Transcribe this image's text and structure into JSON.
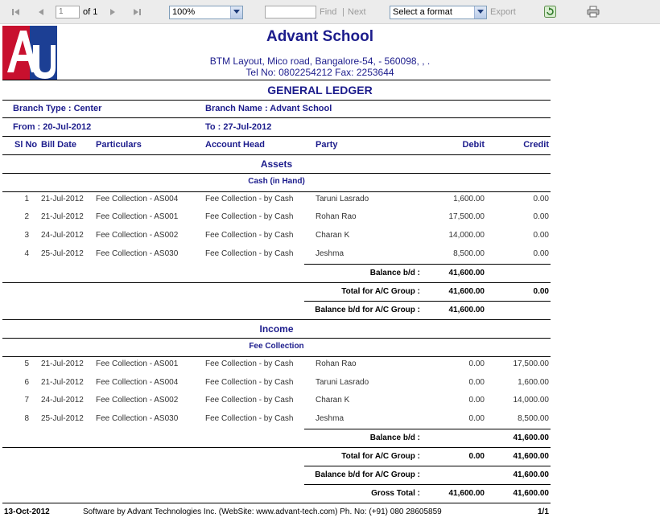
{
  "toolbar": {
    "page_value": "1",
    "page_of": "of 1",
    "zoom": "100%",
    "find_value": "",
    "find_label": "Find",
    "separator": "|",
    "next_label": "Next",
    "format_select": "Select a format",
    "export_label": "Export"
  },
  "header": {
    "school_name": "Advant School",
    "address": "BTM Layout, Mico road, Bangalore-54, - 560098, , .",
    "contact": "Tel No: 0802254212 Fax: 2253644",
    "report_title": "GENERAL LEDGER",
    "branch_type": "Branch Type : Center",
    "branch_name": "Branch Name : Advant School",
    "from": "From : 20-Jul-2012",
    "to": "To : 27-Jul-2012"
  },
  "columns": {
    "sl_no": "Sl No",
    "bill_date": "Bill Date",
    "particulars": "Particulars",
    "account_head": "Account Head",
    "party": "Party",
    "debit": "Debit",
    "credit": "Credit"
  },
  "sections": [
    {
      "title": "Assets",
      "group": "Cash (in Hand)",
      "rows": [
        {
          "sl": "1",
          "date": "21-Jul-2012",
          "particulars": "Fee Collection - AS004",
          "account": "Fee Collection - by Cash",
          "party": "Taruni Lasrado",
          "debit": "1,600.00",
          "credit": "0.00"
        },
        {
          "sl": "2",
          "date": "21-Jul-2012",
          "particulars": "Fee Collection - AS001",
          "account": "Fee Collection - by Cash",
          "party": "Rohan Rao",
          "debit": "17,500.00",
          "credit": "0.00"
        },
        {
          "sl": "3",
          "date": "24-Jul-2012",
          "particulars": "Fee Collection - AS002",
          "account": "Fee Collection - by Cash",
          "party": "Charan K",
          "debit": "14,000.00",
          "credit": "0.00"
        },
        {
          "sl": "4",
          "date": "25-Jul-2012",
          "particulars": "Fee Collection - AS030",
          "account": "Fee Collection - by Cash",
          "party": "Jeshma",
          "debit": "8,500.00",
          "credit": "0.00"
        }
      ],
      "balance": {
        "label": "Balance b/d :",
        "debit": "41,600.00",
        "credit": ""
      },
      "total": {
        "label": "Total for A/C Group :",
        "debit": "41,600.00",
        "credit": "0.00"
      },
      "balance_group": {
        "label": "Balance b/d for A/C Group :",
        "debit": "41,600.00",
        "credit": ""
      }
    },
    {
      "title": "Income",
      "group": "Fee Collection",
      "rows": [
        {
          "sl": "5",
          "date": "21-Jul-2012",
          "particulars": "Fee Collection - AS001",
          "account": "Fee Collection - by Cash",
          "party": "Rohan Rao",
          "debit": "0.00",
          "credit": "17,500.00"
        },
        {
          "sl": "6",
          "date": "21-Jul-2012",
          "particulars": "Fee Collection - AS004",
          "account": "Fee Collection - by Cash",
          "party": "Taruni Lasrado",
          "debit": "0.00",
          "credit": "1,600.00"
        },
        {
          "sl": "7",
          "date": "24-Jul-2012",
          "particulars": "Fee Collection - AS002",
          "account": "Fee Collection - by Cash",
          "party": "Charan K",
          "debit": "0.00",
          "credit": "14,000.00"
        },
        {
          "sl": "8",
          "date": "25-Jul-2012",
          "particulars": "Fee Collection - AS030",
          "account": "Fee Collection - by Cash",
          "party": "Jeshma",
          "debit": "0.00",
          "credit": "8,500.00"
        }
      ],
      "balance": {
        "label": "Balance b/d :",
        "debit": "",
        "credit": "41,600.00"
      },
      "total": {
        "label": "Total for A/C Group :",
        "debit": "0.00",
        "credit": "41,600.00"
      },
      "balance_group": {
        "label": "Balance b/d for A/C Group :",
        "debit": "",
        "credit": "41,600.00"
      }
    }
  ],
  "gross_total": {
    "label": "Gross Total :",
    "debit": "41,600.00",
    "credit": "41,600.00"
  },
  "footer": {
    "date": "13-Oct-2012",
    "software": "Software by Advant Technologies Inc. (WebSite: www.advant-tech.com) Ph. No: (+91) 080 28605859",
    "page": "1/1"
  },
  "colors": {
    "heading": "#1c1c8c",
    "logo_red": "#c8102e",
    "logo_blue": "#1c3f94"
  },
  "icons": [
    "first-page-icon",
    "previous-page-icon",
    "next-page-icon",
    "last-page-icon",
    "refresh-icon",
    "print-icon",
    "school-logo"
  ]
}
